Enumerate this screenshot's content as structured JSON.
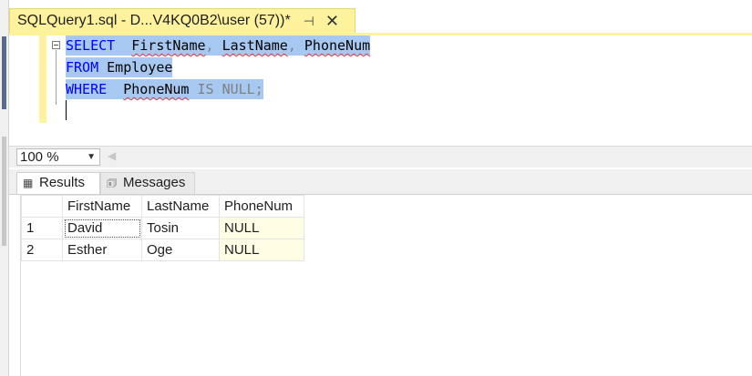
{
  "document_tab": {
    "title": "SQLQuery1.sql - D...V4KQ0B2\\user (57))*",
    "pin_icon": "pin-icon",
    "close_icon": "close-icon"
  },
  "editor": {
    "line1": {
      "kw": "SELECT",
      "cols": [
        "FirstName",
        "LastName",
        "PhoneNum"
      ]
    },
    "line2": {
      "kw": "FROM",
      "table": "Employee"
    },
    "line3": {
      "kw": "WHERE",
      "col": "PhoneNum",
      "rest": "IS NULL;"
    }
  },
  "zoom": {
    "value": "100 %"
  },
  "result_tabs": {
    "results": "Results",
    "messages": "Messages"
  },
  "grid": {
    "columns": [
      "FirstName",
      "LastName",
      "PhoneNum"
    ],
    "rows": [
      {
        "num": "1",
        "FirstName": "David",
        "LastName": "Tosin",
        "PhoneNum": "NULL"
      },
      {
        "num": "2",
        "FirstName": "Esther",
        "LastName": "Oge",
        "PhoneNum": "NULL"
      }
    ]
  },
  "colors": {
    "tab_yellow": "#fff29d",
    "selection_blue": "#a7c8f0",
    "keyword_blue": "#0000ff",
    "null_cell": "#fffde4"
  }
}
